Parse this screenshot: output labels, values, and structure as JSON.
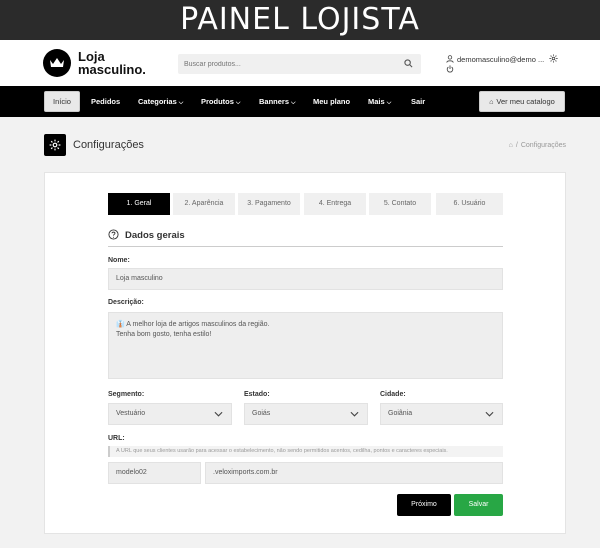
{
  "banner": {
    "title": "PAINEL LOJISTA"
  },
  "header": {
    "logo_line1": "Loja",
    "logo_line2": "masculino.",
    "search_placeholder": "Buscar produtos...",
    "user_email": "demomasculino@demo ...",
    "icons": {
      "search": "search-icon",
      "user": "user-icon",
      "settings": "gear-icon",
      "logout": "power-icon"
    }
  },
  "nav": {
    "home": "Início",
    "items": [
      "Pedidos",
      "Categorias",
      "Produtos",
      "Banners",
      "Meu plano",
      "Mais",
      "Sair"
    ],
    "catalog_button": "Ver meu catalogo"
  },
  "page": {
    "title": "Configurações",
    "breadcrumb_current": "Configurações"
  },
  "tabs": [
    "1. Geral",
    "2. Aparência",
    "3. Pagamento",
    "4. Entrega",
    "5. Contato",
    "6. Usuário"
  ],
  "active_tab": "1. Geral",
  "form": {
    "section_title": "Dados gerais",
    "name_label": "Nome:",
    "name_value": "Loja masculino",
    "description_label": "Descrição:",
    "description_line1": "👔 A melhor loja de artigos masculinos da região.",
    "description_line2": "Tenha bom gosto, tenha estilo!",
    "segment_label": "Segmento:",
    "segment_value": "Vestuário",
    "state_label": "Estado:",
    "state_value": "Goiás",
    "city_label": "Cidade:",
    "city_value": "Goiânia",
    "url_label": "URL:",
    "url_hint": "A URL que seus clientes usarão para acessar o estabelecimento, não sendo permitidos acentos, cedilha, pontos e caracteres especiais.",
    "url_slug": "modelo02",
    "url_domain": ".veloximports.com.br",
    "next_button": "Próximo",
    "save_button": "Salvar"
  },
  "colors": {
    "primary": "#000000",
    "save": "#28a745",
    "field_bg": "#eeeeee",
    "banner_bg": "#2b2b2b"
  }
}
